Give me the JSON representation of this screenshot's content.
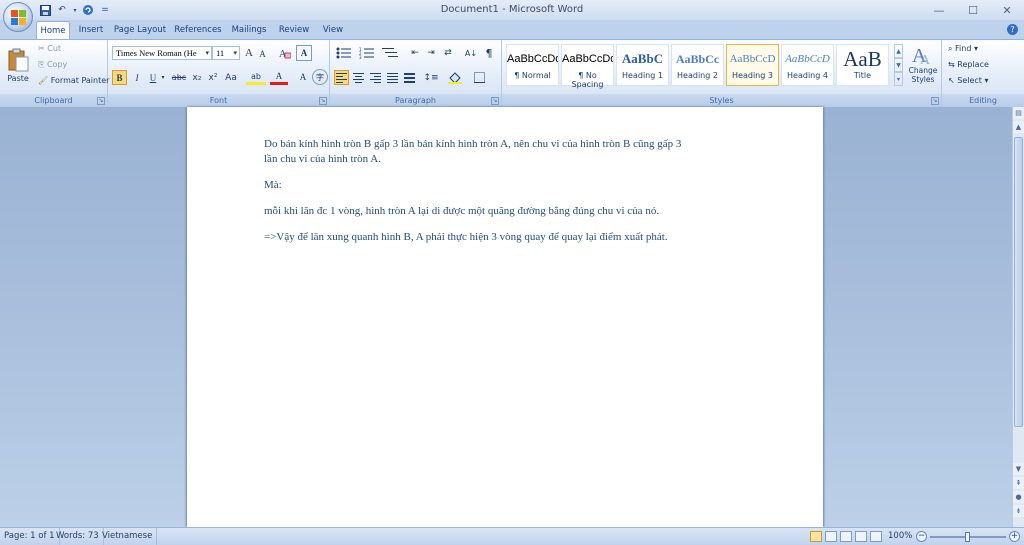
{
  "window": {
    "title": "Document1 - Microsoft Word",
    "minimize": "—",
    "maximize": "☐",
    "close": "✕"
  },
  "quick_access": {
    "save_icon": "save-icon",
    "undo_icon": "undo-icon",
    "redo_icon": "redo-icon",
    "customize": "="
  },
  "tabs": [
    {
      "label": "Home"
    },
    {
      "label": "Insert"
    },
    {
      "label": "Page Layout"
    },
    {
      "label": "References"
    },
    {
      "label": "Mailings"
    },
    {
      "label": "Review"
    },
    {
      "label": "View"
    }
  ],
  "clipboard": {
    "paste": "Paste",
    "cut": "Cut",
    "copy": "Copy",
    "format_painter": "Format Painter",
    "label": "Clipboard"
  },
  "font": {
    "name": "Times New Roman (He",
    "size": "11",
    "bold": "B",
    "italic": "I",
    "underline": "U",
    "strike": "abc",
    "subscript": "x₂",
    "superscript": "x²",
    "change_case": "Aa",
    "grow": "A",
    "shrink": "A",
    "highlight": "ab",
    "font_color": "A",
    "label": "Font"
  },
  "paragraph": {
    "sort": "A↓",
    "show_marks": "¶",
    "label": "Paragraph"
  },
  "styles": {
    "items": [
      {
        "sample": "AaBbCcDd",
        "name": "¶ Normal"
      },
      {
        "sample": "AaBbCcDd",
        "name": "¶ No Spacing"
      },
      {
        "sample": "AaBbC",
        "name": "Heading 1"
      },
      {
        "sample": "AaBbCc",
        "name": "Heading 2"
      },
      {
        "sample": "AaBbCcD",
        "name": "Heading 3"
      },
      {
        "sample": "AaBbCcD",
        "name": "Heading 4"
      },
      {
        "sample": "AaB",
        "name": "Title"
      }
    ],
    "change_styles": "Change Styles",
    "label": "Styles"
  },
  "editing": {
    "find": "Find",
    "replace": "Replace",
    "select": "Select",
    "label": "Editing"
  },
  "document": {
    "paragraphs": [
      "Do bán kính hình tròn B gấp 3 lần bán kính hình tròn A, nên chu vi của hình tròn B cũng gấp 3",
      "lần chu vi của hình tròn A.",
      "Mà:",
      " mỗi khi lăn đc 1 vòng, hình tròn A lại di được một quãng đường bằng đúng chu vi của nó.",
      "=>Vậy để lăn xung quanh hình B, A phải thực hiện 3 vòng quay để quay lại điểm xuất phát."
    ]
  },
  "status": {
    "page": "Page: 1 of 1",
    "words": "Words: 73",
    "language": "Vietnamese",
    "zoom": "100%"
  }
}
